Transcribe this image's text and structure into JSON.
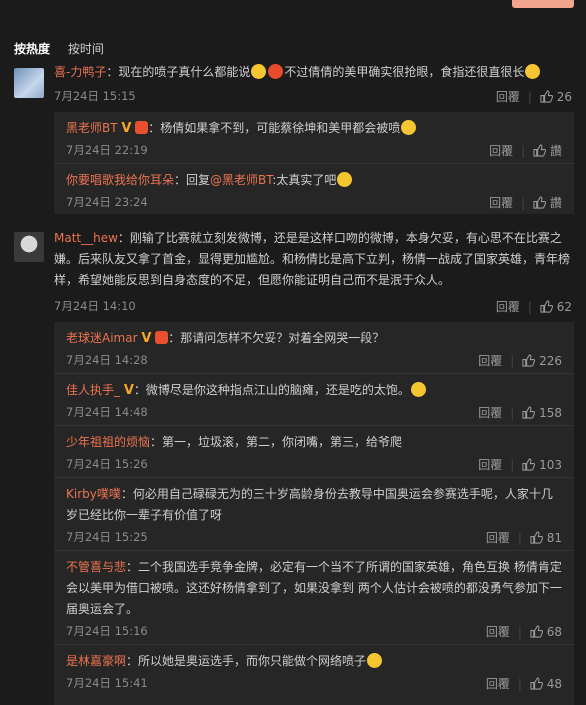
{
  "sort": {
    "hot": "按热度",
    "time": "按时间"
  },
  "ui": {
    "reply_label": "回覆"
  },
  "comments": [
    {
      "name": "喜-力鸭子",
      "text_a": "：现在的喷子真什么都能说",
      "text_b": "不过倩倩的美甲确实很抢眼，食指还很直很长",
      "time": "7月24日 15:15",
      "likes": "26",
      "replies": [
        {
          "name": "黑老师BT",
          "text": "：杨倩如果拿不到，可能蔡徐坤和美甲都会被喷",
          "time": "7月24日 22:19",
          "likes": "讚"
        },
        {
          "name": "你要唱歌我给你耳朵",
          "text_a": "：回复",
          "mention": "@黑老师BT",
          "text_b": ":太真实了吧",
          "time": "7月24日 23:24",
          "likes": "讚"
        }
      ]
    },
    {
      "name": "Matt__hew",
      "text": "：刚输了比赛就立刻发微博，还是是这样口吻的微博，本身欠妥，有心思不在比赛之嫌。后来队友又拿了首金，显得更加尴尬。和杨倩比是高下立判，杨倩一战成了国家英雄，青年榜样，希望她能反思到自身态度的不足，但愿你能证明自己而不是泯于众人。",
      "time": "7月24日 14:10",
      "likes": "62",
      "replies": [
        {
          "name": "老球迷Aimar",
          "text": "：那请问怎样不欠妥？对着全网哭一段？",
          "time": "7月24日 14:28",
          "likes": "226"
        },
        {
          "name": "佳人执手_",
          "text": "：微博尽是你这种指点江山的脑瘫，还是吃的太饱。",
          "time": "7月24日 14:48",
          "likes": "158"
        },
        {
          "name": "少年祖祖的烦恼",
          "text": "：第一，垃圾滚，第二，你闭嘴，第三，给爷爬",
          "time": "7月24日 15:26",
          "likes": "103"
        },
        {
          "name": "Kirby噗噗",
          "text": "：何必用自己碌碌无为的三十岁高龄身份去教导中国奥运会参赛选手呢，人家十几岁已经比你一辈子有价值了呀",
          "time": "7月24日 15:25",
          "likes": "81"
        },
        {
          "name": "不管喜与悲",
          "text": "：二个我国选手竞争金牌，必定有一个当不了所谓的国家英雄，角色互换 杨倩肯定会以美甲为借口被喷。这还好杨倩拿到了，如果没拿到 两个人估计会被喷的都没勇气参加下一届奥运会了。",
          "time": "7月24日 15:16",
          "likes": "68"
        },
        {
          "name": "是林嘉豪啊",
          "text": "：所以她是奥运选手，而你只能做个网络喷子",
          "time": "7月24日 15:41",
          "likes": "48"
        }
      ]
    }
  ]
}
